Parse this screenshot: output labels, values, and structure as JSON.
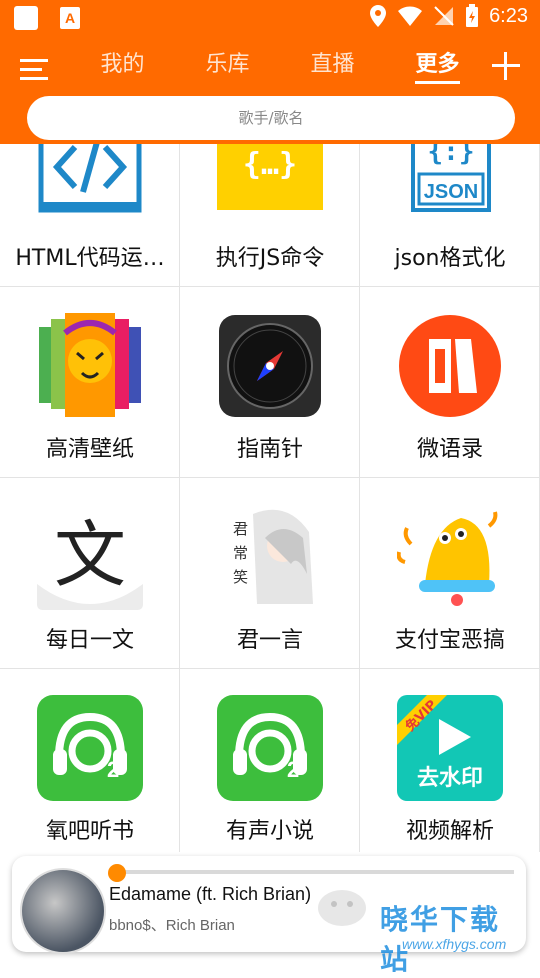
{
  "status": {
    "time": "6:23",
    "app_icon_letter": "A"
  },
  "nav": {
    "tabs": [
      {
        "label": "我的",
        "active": false
      },
      {
        "label": "乐库",
        "active": false
      },
      {
        "label": "直播",
        "active": false
      },
      {
        "label": "更多",
        "active": true
      }
    ]
  },
  "search": {
    "placeholder": "歌手/歌名"
  },
  "grid": {
    "items": [
      {
        "label": "HTML代码运…",
        "icon": "html-code-icon"
      },
      {
        "label": "执行JS命令",
        "icon": "js-braces-icon"
      },
      {
        "label": "json格式化",
        "icon": "json-file-icon"
      },
      {
        "label": "高清壁纸",
        "icon": "lion-wallpaper-icon"
      },
      {
        "label": "指南针",
        "icon": "compass-icon"
      },
      {
        "label": "微语录",
        "icon": "quote-icon"
      },
      {
        "label": "每日一文",
        "icon": "wen-character-icon"
      },
      {
        "label": "君一言",
        "icon": "anime-portrait-icon"
      },
      {
        "label": "支付宝恶搞",
        "icon": "bell-icon"
      },
      {
        "label": "氧吧听书",
        "icon": "headphones-o2-icon"
      },
      {
        "label": "有声小说",
        "icon": "headphones-o2-icon"
      },
      {
        "label": "视频解析",
        "icon": "play-video-icon"
      }
    ],
    "icon_texts": {
      "json": "JSON",
      "js": "{…}",
      "wen": "文",
      "vip": "免VIP",
      "watermark": "去水印",
      "jun": [
        "君",
        "常",
        "笑"
      ]
    }
  },
  "player": {
    "song": "Edamame (ft. Rich Brian)",
    "artist": "bbno$、Rich Brian",
    "progress": 0.02
  },
  "watermark": {
    "text": "晓华下载站",
    "url": "www.xfhygs.com"
  },
  "colors": {
    "accent": "#ff6a00",
    "green": "#3dbe3d",
    "teal": "#12c7b5"
  }
}
